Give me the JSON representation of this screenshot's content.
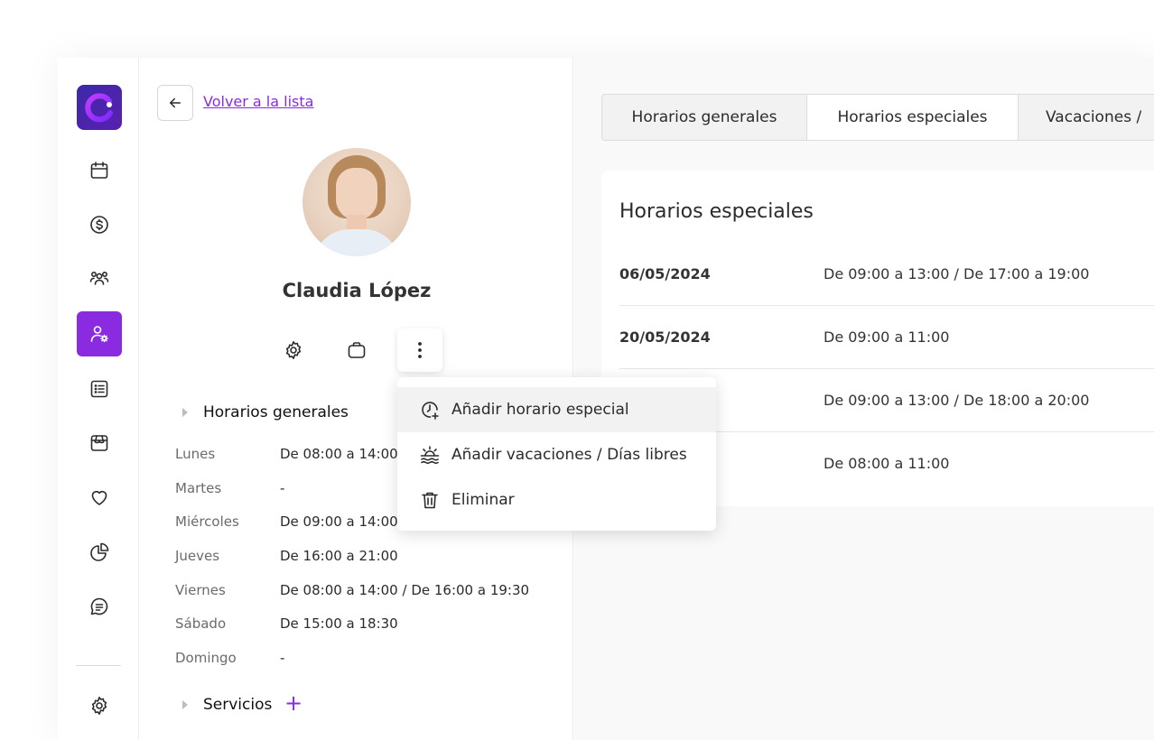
{
  "sidebar": {
    "items": [
      {
        "icon": "calendar-icon"
      },
      {
        "icon": "dollar-icon"
      },
      {
        "icon": "users-icon"
      },
      {
        "icon": "user-settings-icon",
        "active": true
      },
      {
        "icon": "list-icon"
      },
      {
        "icon": "store-icon"
      },
      {
        "icon": "heart-icon"
      },
      {
        "icon": "pie-chart-icon"
      },
      {
        "icon": "message-icon"
      }
    ],
    "settings_icon": "gear-icon"
  },
  "profile": {
    "back_label": "Volver a la lista",
    "name": "Claudia López",
    "general_title": "Horarios generales",
    "schedule": [
      {
        "day": "Lunes",
        "time": "De 08:00 a 14:00"
      },
      {
        "day": "Martes",
        "time": "-"
      },
      {
        "day": "Miércoles",
        "time": "De 09:00 a 14:00"
      },
      {
        "day": "Jueves",
        "time": "De 16:00 a 21:00"
      },
      {
        "day": "Viernes",
        "time": "De 08:00 a 14:00 / De 16:00 a 19:30"
      },
      {
        "day": "Sábado",
        "time": "De 15:00 a 18:30"
      },
      {
        "day": "Domingo",
        "time": "-"
      }
    ],
    "services_title": "Servicios",
    "services_add": "+"
  },
  "tabs": [
    {
      "label": "Horarios generales"
    },
    {
      "label": "Horarios especiales",
      "active": true
    },
    {
      "label": "Vacaciones /"
    }
  ],
  "special": {
    "title": "Horarios especiales",
    "rows": [
      {
        "date": "06/05/2024",
        "time": "De 09:00 a 13:00 / De 17:00 a 19:00"
      },
      {
        "date": "20/05/2024",
        "time": "De 09:00 a 11:00"
      },
      {
        "date": "",
        "time": "De 09:00 a 13:00 / De 18:00 a 20:00"
      },
      {
        "date": "",
        "time": "De 08:00 a 11:00"
      }
    ]
  },
  "menu": {
    "items": [
      {
        "label": "Añadir horario especial",
        "icon": "clock-plus-icon"
      },
      {
        "label": "Añadir vacaciones / Días libres",
        "icon": "sunset-icon"
      },
      {
        "label": "Eliminar",
        "icon": "trash-icon"
      }
    ]
  },
  "colors": {
    "accent": "#8a2be2"
  }
}
